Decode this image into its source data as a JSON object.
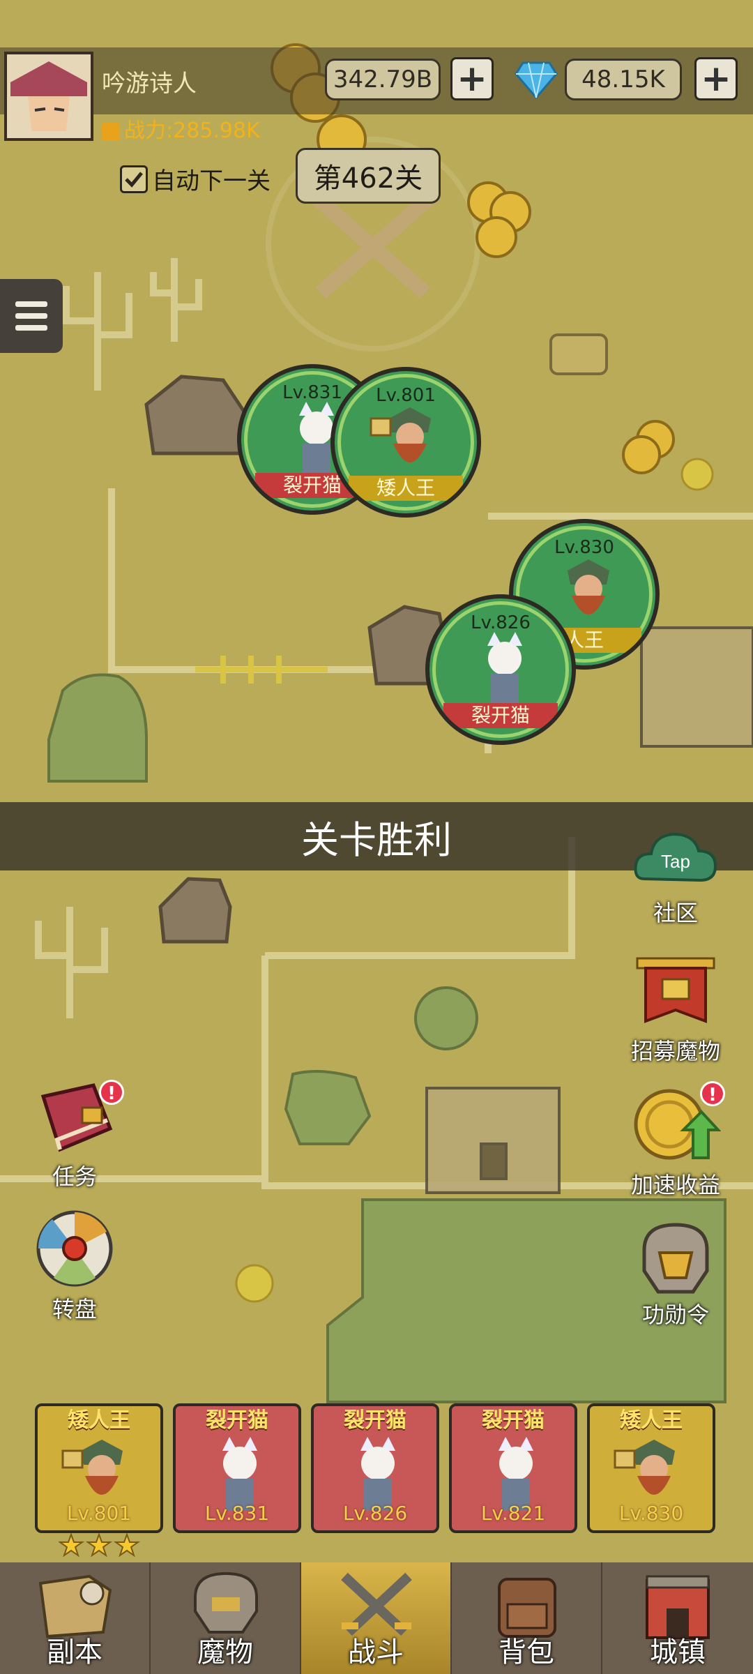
{
  "player": {
    "name": "吟游诗人",
    "power": "战力:285.98K"
  },
  "currency": {
    "gold": "342.79B",
    "gems": "48.15K"
  },
  "auto_next": {
    "label": "自动下一关",
    "checked": true
  },
  "stage": {
    "label": "第462关"
  },
  "battle_banner": "关卡胜利",
  "units_on_map": [
    {
      "level": "Lv.831",
      "name": "裂开猫"
    },
    {
      "level": "Lv.801",
      "name": "矮人王"
    },
    {
      "level": "Lv.830",
      "name": "人王"
    },
    {
      "level": "Lv.826",
      "name": "裂开猫"
    }
  ],
  "right_menu": [
    {
      "label": "社区",
      "icon_text": "Tap"
    },
    {
      "label": "招募魔物"
    },
    {
      "label": "加速收益",
      "badge": "!"
    },
    {
      "label": "功勋令"
    }
  ],
  "left_menu": [
    {
      "label": "任务",
      "badge": "!"
    },
    {
      "label": "转盘"
    }
  ],
  "team": [
    {
      "name": "矮人王",
      "level": "Lv.801",
      "stars": 3
    },
    {
      "name": "裂开猫",
      "level": "Lv.831"
    },
    {
      "name": "裂开猫",
      "level": "Lv.826"
    },
    {
      "name": "裂开猫",
      "level": "Lv.821"
    },
    {
      "name": "矮人王",
      "level": "Lv.830"
    }
  ],
  "nav": [
    {
      "label": "副本"
    },
    {
      "label": "魔物"
    },
    {
      "label": "战斗",
      "active": true
    },
    {
      "label": "背包"
    },
    {
      "label": "城镇"
    }
  ],
  "colors": {
    "map": "#b9ab57",
    "unit_green": "#3f9a55",
    "gold": "#f2b21b"
  }
}
